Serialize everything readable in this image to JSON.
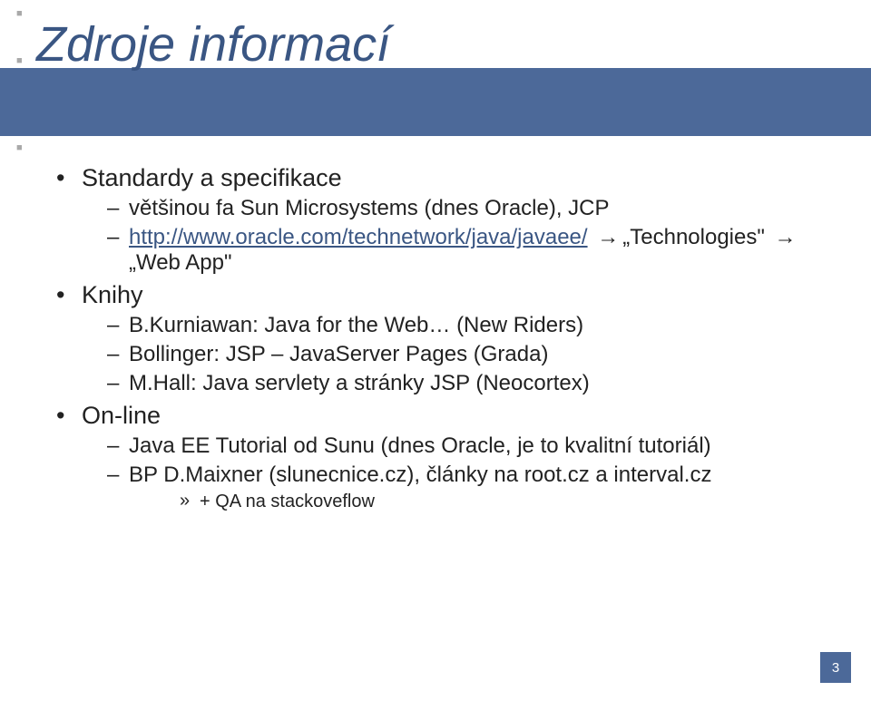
{
  "title": "Zdroje informací",
  "content": {
    "items": [
      {
        "label": "Standardy a specifikace",
        "children": [
          {
            "label": "většinou fa Sun Microsystems (dnes Oracle), JCP"
          },
          {
            "link": "http://www.oracle.com/technetwork/java/javaee/",
            "tail_parts": [
              "„Technologies\"",
              "„Web App\""
            ]
          }
        ]
      },
      {
        "label": "Knihy",
        "children": [
          {
            "label": "B.Kurniawan: Java for the Web… (New Riders)"
          },
          {
            "label": "Bollinger: JSP – JavaServer Pages (Grada)"
          },
          {
            "label": "M.Hall: Java servlety a stránky JSP (Neocortex)"
          }
        ]
      },
      {
        "label": "On-line",
        "children": [
          {
            "label": "Java EE Tutorial od Sunu (dnes Oracle, je to kvalitní tutoriál)"
          },
          {
            "label": "BP D.Maixner (slunecnice.cz), články na root.cz a interval.cz",
            "children": [
              {
                "label": "+ QA na stackoveflow"
              }
            ]
          }
        ]
      }
    ]
  },
  "arrow_glyph": "→",
  "page_number": "3"
}
